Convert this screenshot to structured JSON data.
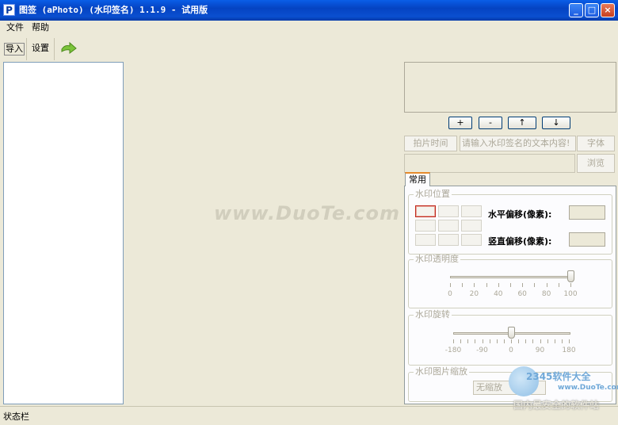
{
  "window": {
    "title": "图签 (aPhoto)  (水印签名)  1.1.9 - 试用版",
    "icon_letter": "P",
    "controls": {
      "minimize": "_",
      "maximize": "□",
      "close": "×"
    }
  },
  "menu": {
    "file": "文件",
    "help": "帮助"
  },
  "toolbar": {
    "import": "导入",
    "settings": "设置",
    "go_icon": "arrow-right-icon"
  },
  "preview": {
    "watermark": "www.DuoTe.com"
  },
  "text_buttons": {
    "add": "+",
    "remove": "-",
    "up": "↑",
    "down": "↓"
  },
  "inputs": {
    "capture_time": "拍片时间",
    "text_placeholder": "请输入水印签名的文本内容!",
    "font_button": "字体",
    "browse_button": "浏览"
  },
  "tabs": {
    "common": "常用"
  },
  "position": {
    "title": "水印位置",
    "horizontal_offset_label": "水平偏移(像素):",
    "vertical_offset_label": "竖直偏移(像素):",
    "horizontal_offset_value": "",
    "vertical_offset_value": ""
  },
  "opacity": {
    "title": "水印透明度",
    "value": 100,
    "ticks": [
      "0",
      "20",
      "40",
      "60",
      "80",
      "100"
    ]
  },
  "rotation": {
    "title": "水印旋转",
    "value": 0,
    "ticks": [
      "-180",
      "-90",
      "0",
      "90",
      "180"
    ]
  },
  "scale": {
    "title": "水印图片缩放",
    "option": "无缩放"
  },
  "status": {
    "text": "状态栏"
  },
  "badge": {
    "line1": "2345软件大全",
    "line2": "www.DuoTe.com",
    "line3": "国内最安全的软件站"
  }
}
